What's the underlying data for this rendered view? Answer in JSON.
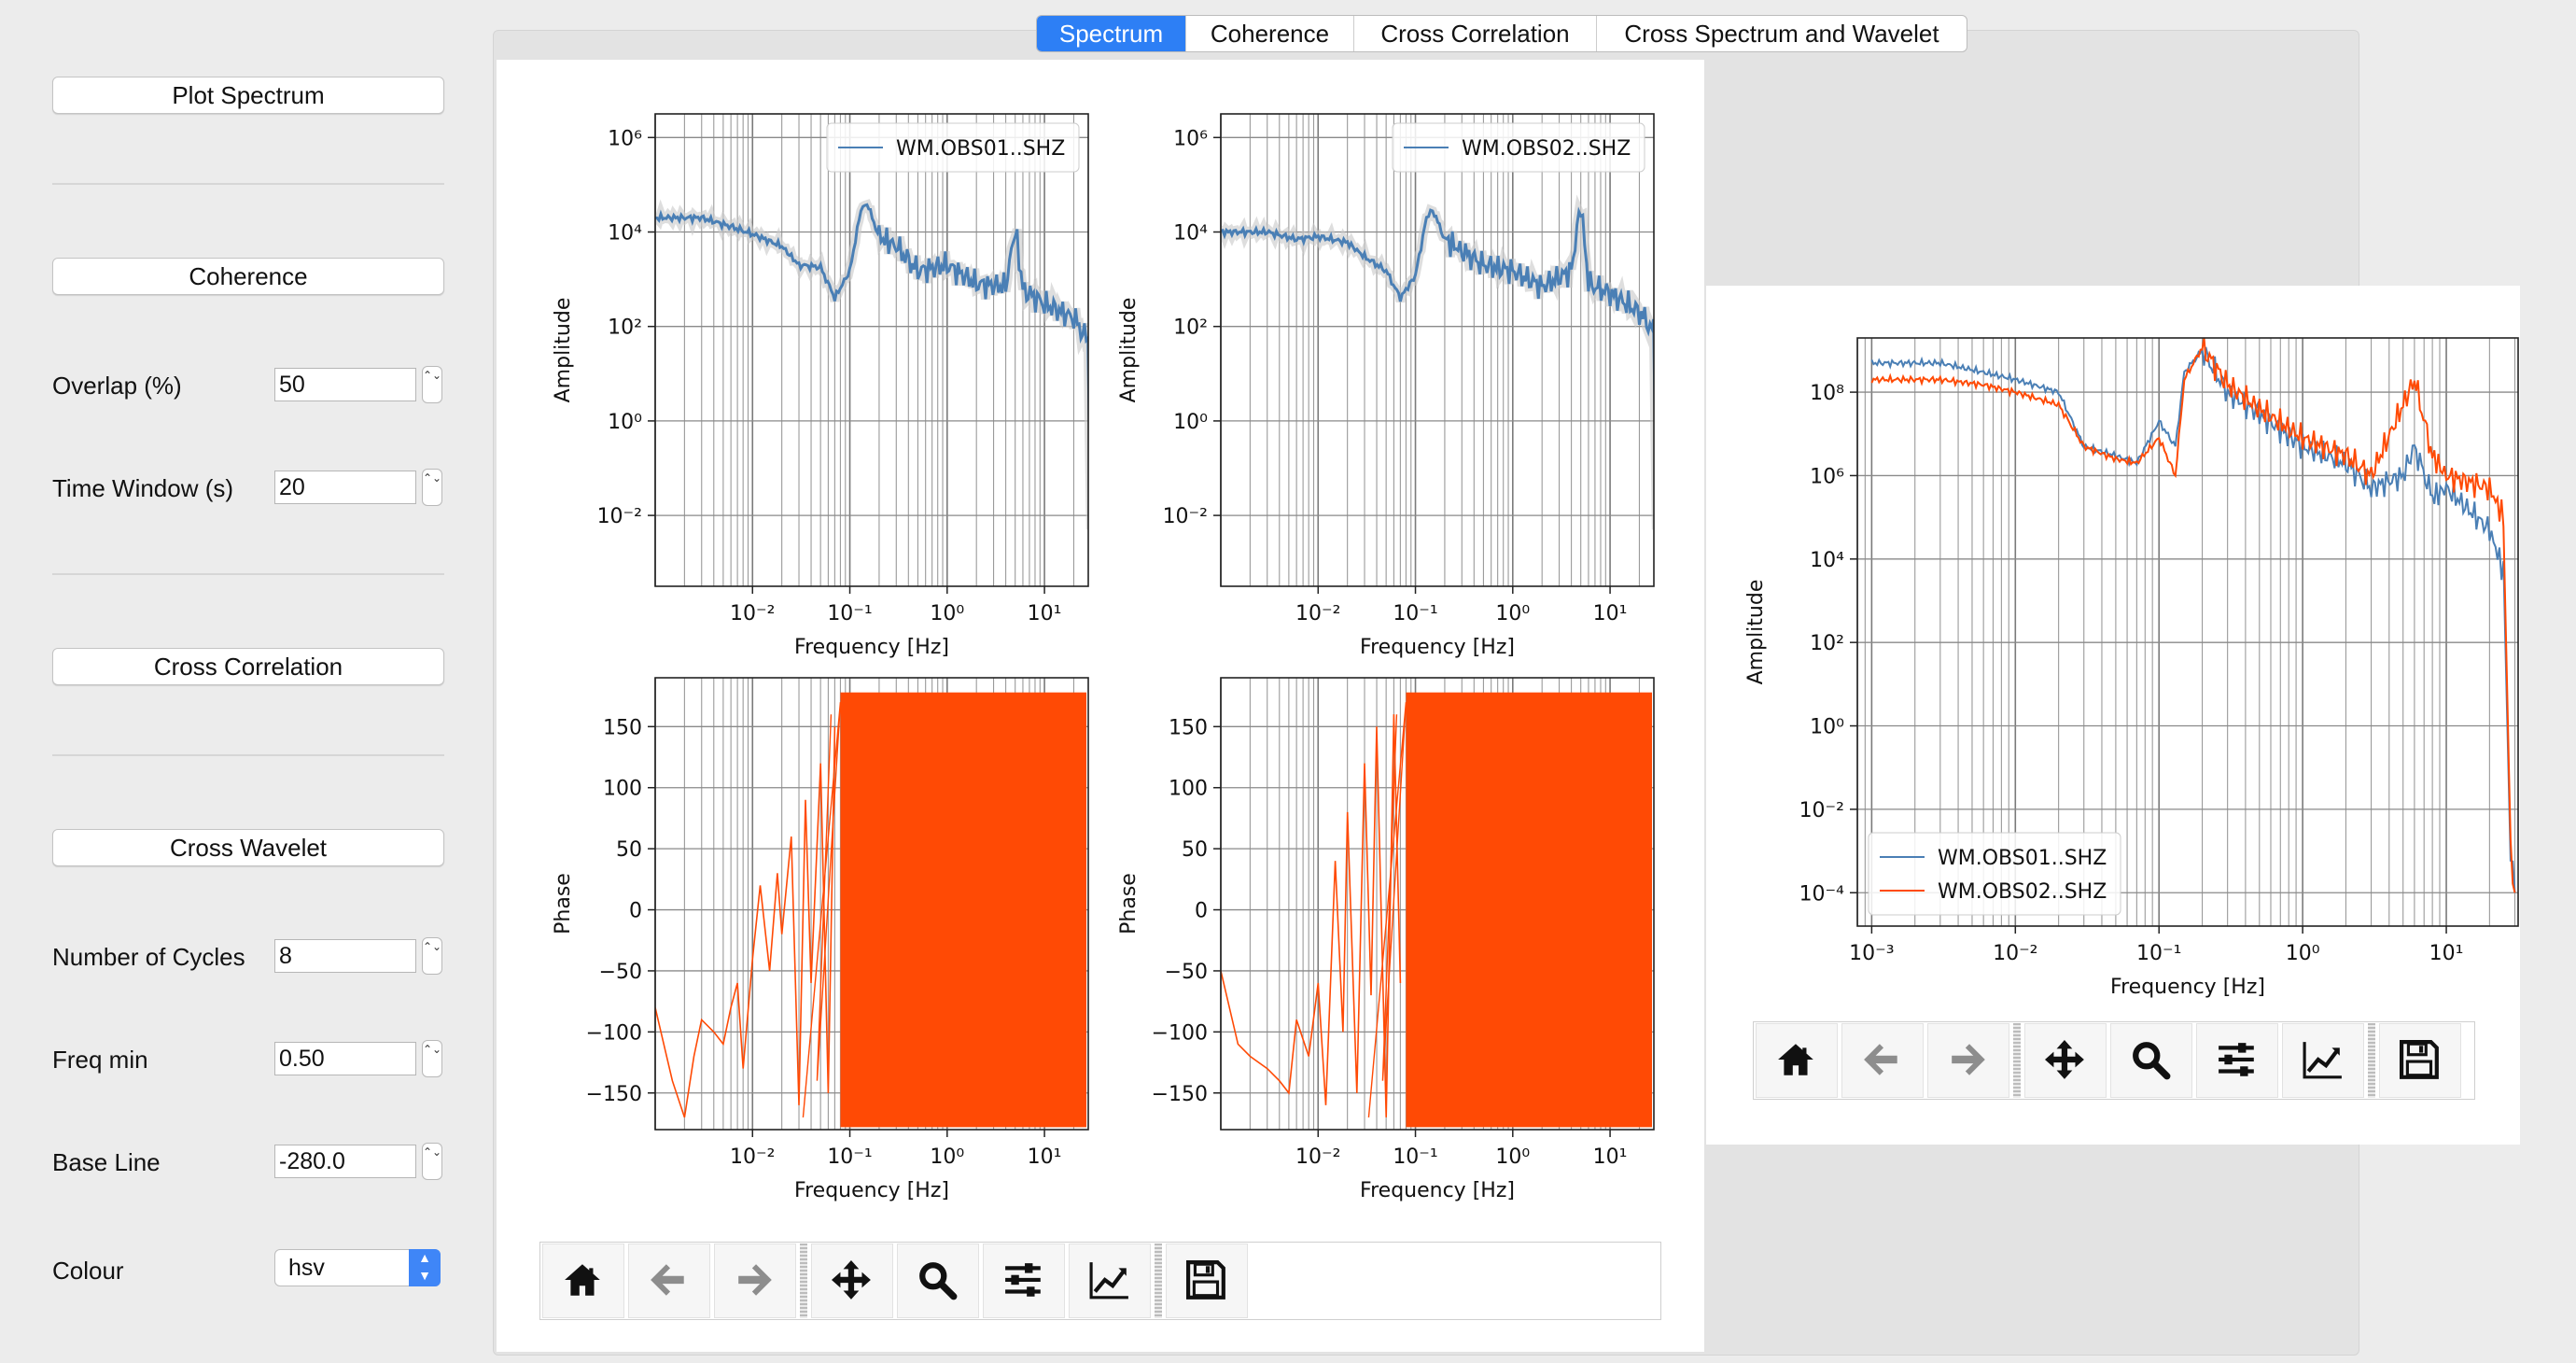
{
  "tabs": [
    {
      "label": "Spectrum",
      "active": true
    },
    {
      "label": "Coherence",
      "active": false
    },
    {
      "label": "Cross Correlation",
      "active": false
    },
    {
      "label": "Cross Spectrum and Wavelet",
      "active": false
    }
  ],
  "sidebar": {
    "plot_spectrum": "Plot Spectrum",
    "coherence": "Coherence",
    "overlap_label": "Overlap (%)",
    "overlap_value": "50",
    "time_window_label": "Time Window (s)",
    "time_window_value": "20",
    "cross_correlation": "Cross Correlation",
    "cross_wavelet": "Cross Wavelet",
    "cycles_label": "Number of Cycles",
    "cycles_value": "8",
    "freq_min_label": "Freq min",
    "freq_min_value": "0.50",
    "base_line_label": "Base Line",
    "base_line_value": "-280.0",
    "colour_label": "Colour",
    "colour_value": "hsv",
    "stepper_glyph": "⌃⌄"
  },
  "colors": {
    "blue": "#4a7fb5",
    "orange": "#ff4a05",
    "accent": "#2d7ff5"
  },
  "toolbar_icons": [
    "home-icon",
    "back-arrow-icon",
    "forward-arrow-icon",
    "pan-icon",
    "zoom-icon",
    "configure-subplots-icon",
    "edit-axis-icon",
    "save-icon"
  ],
  "chart_data": [
    {
      "type": "line",
      "xscale": "log",
      "yscale": "log",
      "xlabel": "Frequency [Hz]",
      "ylabel": "Amplitude",
      "x_ticks": [
        "10⁻²",
        "10⁻¹",
        "10⁰",
        "10¹"
      ],
      "y_ticks": [
        "10⁻²",
        "10⁰",
        "10²",
        "10⁴",
        "10⁶"
      ],
      "legend": "top-right",
      "series": [
        {
          "name": "WM.OBS01..SHZ",
          "color": "#4a7fb5",
          "x": [
            0.001,
            0.003,
            0.006,
            0.01,
            0.02,
            0.03,
            0.05,
            0.07,
            0.1,
            0.13,
            0.15,
            0.2,
            0.3,
            0.5,
            1,
            2,
            4,
            5,
            6,
            10,
            20,
            28,
            30
          ],
          "y": [
            20000,
            20000,
            13000,
            9000,
            5000,
            2000,
            1800,
            400,
            1500,
            30000,
            40000,
            8000,
            5000,
            1500,
            2000,
            800,
            700,
            12000,
            600,
            300,
            150,
            50,
            0.005
          ]
        }
      ]
    },
    {
      "type": "line",
      "xscale": "log",
      "yscale": "log",
      "xlabel": "Frequency [Hz]",
      "ylabel": "Amplitude",
      "x_ticks": [
        "10⁻²",
        "10⁻¹",
        "10⁰",
        "10¹"
      ],
      "y_ticks": [
        "10⁻²",
        "10⁰",
        "10²",
        "10⁴",
        "10⁶"
      ],
      "legend": "top-right",
      "series": [
        {
          "name": "WM.OBS02..SHZ",
          "color": "#4a7fb5",
          "x": [
            0.001,
            0.003,
            0.006,
            0.01,
            0.02,
            0.03,
            0.05,
            0.07,
            0.1,
            0.13,
            0.15,
            0.2,
            0.3,
            0.5,
            1,
            2,
            4,
            5,
            6,
            10,
            20,
            28,
            30
          ],
          "y": [
            10000,
            10000,
            7000,
            8000,
            6000,
            3000,
            1500,
            400,
            1200,
            20000,
            30000,
            7000,
            4000,
            2000,
            1500,
            700,
            1500,
            40000,
            800,
            500,
            200,
            80,
            0.005
          ]
        }
      ]
    },
    {
      "type": "line",
      "xscale": "log",
      "xlabel": "Frequency [Hz]",
      "ylabel": "Phase",
      "ylim": [
        -180,
        180
      ],
      "x_ticks": [
        "10⁻²",
        "10⁻¹",
        "10⁰",
        "10¹"
      ],
      "y_ticks": [
        "150",
        "100",
        "50",
        "0",
        "−50",
        "−100",
        "−150"
      ],
      "series": [
        {
          "color": "#ff4a05",
          "dense_from": 0.08,
          "x": [
            0.001,
            0.0015,
            0.002,
            0.0025,
            0.003,
            0.004,
            0.005,
            0.006,
            0.007,
            0.008,
            0.01,
            0.012,
            0.015,
            0.018,
            0.02,
            0.025,
            0.03,
            0.035,
            0.04,
            0.05,
            0.06,
            0.07
          ],
          "y": [
            -80,
            -140,
            -170,
            -120,
            -90,
            -100,
            -110,
            -80,
            -60,
            -130,
            -40,
            20,
            -50,
            30,
            -20,
            60,
            -160,
            90,
            -60,
            120,
            -150,
            150
          ]
        }
      ]
    },
    {
      "type": "line",
      "xscale": "log",
      "xlabel": "Frequency [Hz]",
      "ylabel": "Phase",
      "ylim": [
        -180,
        180
      ],
      "x_ticks": [
        "10⁻²",
        "10⁻¹",
        "10⁰",
        "10¹"
      ],
      "y_ticks": [
        "150",
        "100",
        "50",
        "0",
        "−50",
        "−100",
        "−150"
      ],
      "series": [
        {
          "color": "#ff4a05",
          "dense_from": 0.08,
          "x": [
            0.001,
            0.0015,
            0.002,
            0.003,
            0.004,
            0.005,
            0.006,
            0.008,
            0.01,
            0.012,
            0.015,
            0.018,
            0.02,
            0.025,
            0.03,
            0.035,
            0.04,
            0.05,
            0.06,
            0.07
          ],
          "y": [
            -50,
            -110,
            -120,
            -130,
            -140,
            -150,
            -90,
            -120,
            -60,
            -160,
            40,
            -100,
            80,
            -150,
            120,
            -70,
            150,
            -170,
            160,
            -60
          ]
        }
      ]
    },
    {
      "type": "line",
      "xscale": "log",
      "yscale": "log",
      "xlabel": "Frequency [Hz]",
      "ylabel": "Amplitude",
      "x_ticks": [
        "10⁻³",
        "10⁻²",
        "10⁻¹",
        "10⁰",
        "10¹"
      ],
      "y_ticks": [
        "10⁻⁴",
        "10⁻²",
        "10⁰",
        "10²",
        "10⁴",
        "10⁶",
        "10⁸"
      ],
      "legend": "lower-left",
      "series": [
        {
          "name": "WM.OBS01..SHZ",
          "color": "#4a7fb5",
          "x": [
            0.001,
            0.003,
            0.006,
            0.01,
            0.02,
            0.03,
            0.05,
            0.07,
            0.1,
            0.13,
            0.15,
            0.2,
            0.3,
            0.5,
            1,
            2,
            3,
            5,
            6,
            8,
            10,
            20,
            25,
            28,
            30
          ],
          "y": [
            500000000,
            500000000,
            300000000,
            200000000,
            100000000,
            5000000,
            3000000,
            2000000,
            20000000,
            5000000,
            300000000,
            1000000000,
            100000000,
            30000000,
            5000000,
            2000000,
            500000,
            1000000,
            5000000,
            300000,
            500000,
            50000,
            5000,
            0.001,
            0.0001
          ]
        },
        {
          "name": "WM.OBS02..SHZ",
          "color": "#ff4a05",
          "x": [
            0.001,
            0.003,
            0.006,
            0.01,
            0.02,
            0.03,
            0.05,
            0.07,
            0.1,
            0.13,
            0.15,
            0.2,
            0.3,
            0.5,
            1,
            2,
            3,
            5,
            6,
            8,
            10,
            20,
            25,
            28,
            30
          ],
          "y": [
            200000000,
            200000000,
            150000000,
            100000000,
            50000000,
            5000000,
            2500000,
            2000000,
            8000000,
            1000000,
            200000000,
            1200000000,
            150000000,
            40000000,
            8000000,
            3000000,
            1000000,
            50000000,
            200000000,
            3000000,
            1000000,
            500000,
            100000,
            0.001,
            0.0001
          ]
        }
      ]
    }
  ]
}
